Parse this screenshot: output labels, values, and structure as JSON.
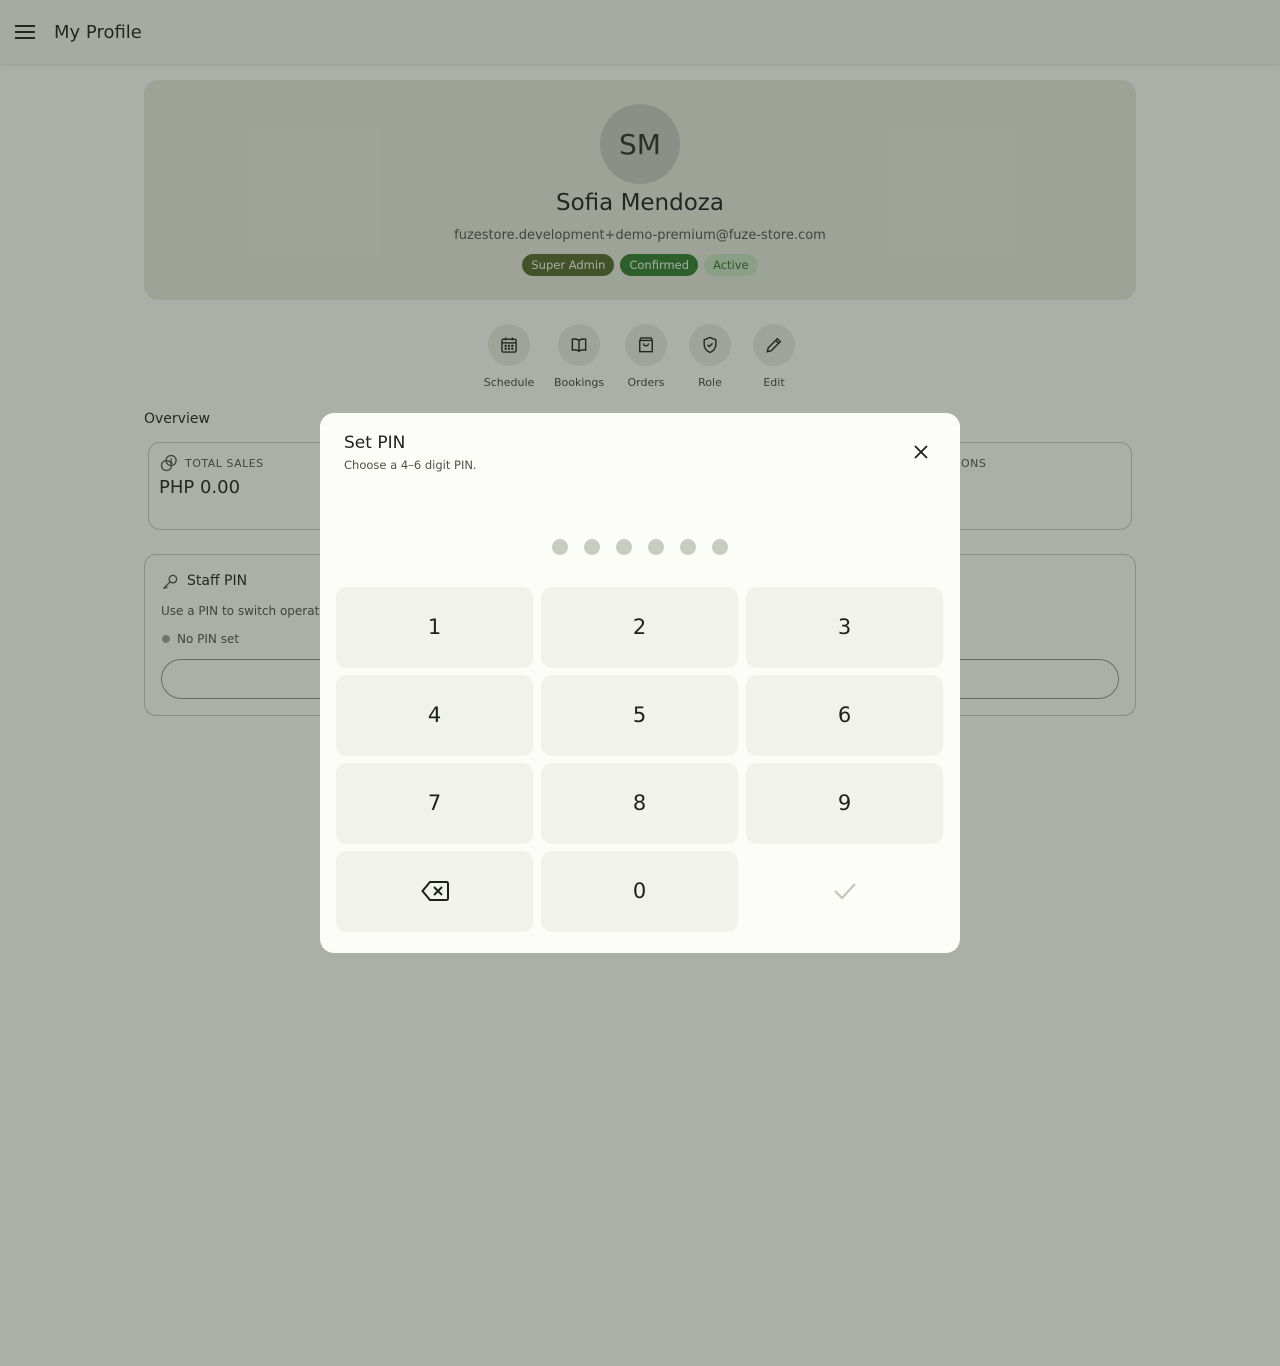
{
  "appbar": {
    "title": "My Profile",
    "menu_icon": "menu-icon"
  },
  "profile": {
    "initials": "SM",
    "name": "Sofia Mendoza",
    "email": "fuzestore.development+demo-premium@fuze-store.com",
    "badges": [
      "Super Admin",
      "Confirmed",
      "Active"
    ]
  },
  "actions": [
    {
      "label": "Schedule",
      "icon": "calendar-icon"
    },
    {
      "label": "Bookings",
      "icon": "book-icon"
    },
    {
      "label": "Orders",
      "icon": "shopping-bag-icon"
    },
    {
      "label": "Role",
      "icon": "shield-check-icon"
    },
    {
      "label": "Edit",
      "icon": "pencil-icon"
    }
  ],
  "overview": {
    "label": "Overview",
    "total_sales": {
      "title": "TOTAL SALES",
      "value": "PHP 0.00"
    },
    "right_card_title_visible": "ONS"
  },
  "staff_pin": {
    "title": "Staff PIN",
    "description_visible": "Use a PIN to switch operators",
    "status": "No PIN set"
  },
  "dialog": {
    "title": "Set PIN",
    "subtitle": "Choose a 4–6 digit PIN.",
    "pin_length_max": 6,
    "pin_entered": 0,
    "keys": [
      "1",
      "2",
      "3",
      "4",
      "5",
      "6",
      "7",
      "8",
      "9",
      "",
      "0",
      ""
    ],
    "backspace_icon": "backspace-icon",
    "confirm_icon": "check-icon",
    "close_icon": "close-icon"
  },
  "colors": {
    "badge_super_admin": "#4f6a2a",
    "badge_confirmed": "#2e7d2e",
    "badge_active": "#c6e4c0",
    "scrim": "#2c3028"
  }
}
